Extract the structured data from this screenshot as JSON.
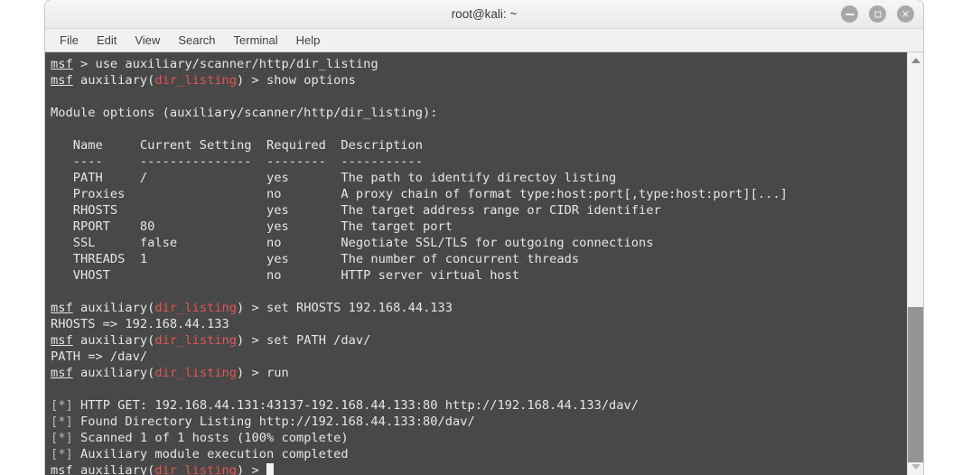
{
  "window": {
    "title": "root@kali: ~",
    "controls": [
      {
        "name": "minimize",
        "glyph": "−"
      },
      {
        "name": "maximize",
        "glyph": "□"
      },
      {
        "name": "close",
        "glyph": "×"
      }
    ]
  },
  "menubar": {
    "items": [
      "File",
      "Edit",
      "View",
      "Search",
      "Terminal",
      "Help"
    ]
  },
  "terminal": {
    "prompt_user": "msf",
    "module_name": "dir_listing",
    "colors": {
      "background": "#484848",
      "foreground": "#e6e6e6",
      "module_red": "#e0564f",
      "status_dim": "#b9b9b9",
      "cursor": "#f2f2f2"
    },
    "lines": [
      {
        "type": "prompt",
        "prompt": "msf",
        "module": null,
        "command": " > use auxiliary/scanner/http/dir_listing"
      },
      {
        "type": "prompt",
        "prompt": "msf",
        "module": "dir_listing",
        "command": " > show options"
      },
      {
        "type": "blank",
        "text": ""
      },
      {
        "type": "out",
        "text": "Module options (auxiliary/scanner/http/dir_listing):"
      },
      {
        "type": "blank",
        "text": ""
      },
      {
        "type": "out",
        "text": "   Name     Current Setting  Required  Description"
      },
      {
        "type": "out",
        "text": "   ----     ---------------  --------  -----------"
      },
      {
        "type": "out",
        "text": "   PATH     /                yes       The path to identify directoy listing"
      },
      {
        "type": "out",
        "text": "   Proxies                   no        A proxy chain of format type:host:port[,type:host:port][...]"
      },
      {
        "type": "out",
        "text": "   RHOSTS                    yes       The target address range or CIDR identifier"
      },
      {
        "type": "out",
        "text": "   RPORT    80               yes       The target port"
      },
      {
        "type": "out",
        "text": "   SSL      false            no        Negotiate SSL/TLS for outgoing connections"
      },
      {
        "type": "out",
        "text": "   THREADS  1                yes       The number of concurrent threads"
      },
      {
        "type": "out",
        "text": "   VHOST                     no        HTTP server virtual host"
      },
      {
        "type": "blank",
        "text": ""
      },
      {
        "type": "prompt",
        "prompt": "msf",
        "module": "dir_listing",
        "command": " > set RHOSTS 192.168.44.133"
      },
      {
        "type": "out",
        "text": "RHOSTS => 192.168.44.133"
      },
      {
        "type": "prompt",
        "prompt": "msf",
        "module": "dir_listing",
        "command": " > set PATH /dav/"
      },
      {
        "type": "out",
        "text": "PATH => /dav/"
      },
      {
        "type": "prompt",
        "prompt": "msf",
        "module": "dir_listing",
        "command": " > run"
      },
      {
        "type": "blank",
        "text": ""
      },
      {
        "type": "status",
        "marker": "[*]",
        "text": " HTTP GET: 192.168.44.131:43137-192.168.44.133:80 http://192.168.44.133/dav/"
      },
      {
        "type": "status",
        "marker": "[*]",
        "text": " Found Directory Listing http://192.168.44.133:80/dav/"
      },
      {
        "type": "status",
        "marker": "[*]",
        "text": " Scanned 1 of 1 hosts (100% complete)"
      },
      {
        "type": "status",
        "marker": "[*]",
        "text": " Auxiliary module execution completed"
      },
      {
        "type": "prompt_cursor",
        "prompt": "msf",
        "module": "dir_listing",
        "command": " > "
      }
    ]
  },
  "scrollbar": {
    "up_arrow": "scroll-up",
    "down_arrow": "scroll-down"
  },
  "table_data": {
    "headers": [
      "Name",
      "Current Setting",
      "Required",
      "Description"
    ],
    "rows": [
      {
        "name": "PATH",
        "current": "/",
        "required": "yes",
        "description": "The path to identify directoy listing"
      },
      {
        "name": "Proxies",
        "current": "",
        "required": "no",
        "description": "A proxy chain of format type:host:port[,type:host:port][...]"
      },
      {
        "name": "RHOSTS",
        "current": "",
        "required": "yes",
        "description": "The target address range or CIDR identifier"
      },
      {
        "name": "RPORT",
        "current": "80",
        "required": "yes",
        "description": "The target port"
      },
      {
        "name": "SSL",
        "current": "false",
        "required": "no",
        "description": "Negotiate SSL/TLS for outgoing connections"
      },
      {
        "name": "THREADS",
        "current": "1",
        "required": "yes",
        "description": "The number of concurrent threads"
      },
      {
        "name": "VHOST",
        "current": "",
        "required": "no",
        "description": "HTTP server virtual host"
      }
    ]
  }
}
